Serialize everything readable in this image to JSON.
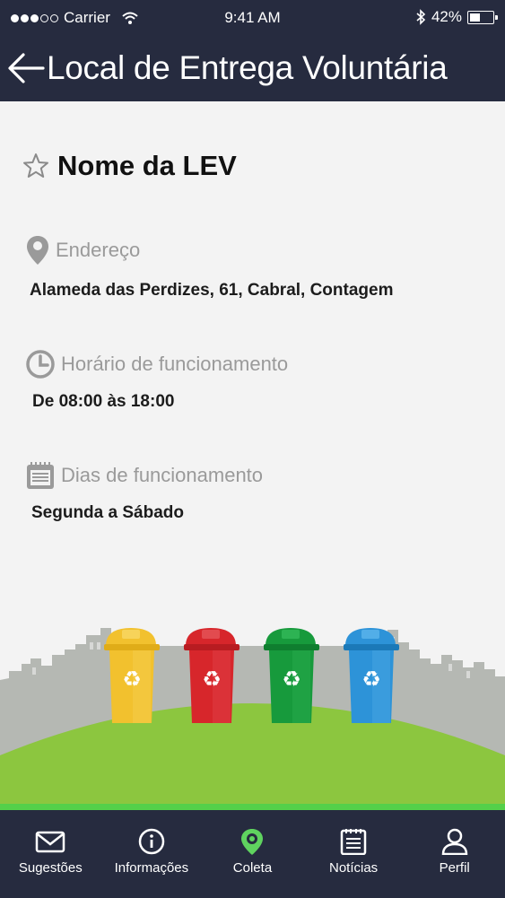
{
  "status_bar": {
    "carrier": "Carrier",
    "time": "9:41 AM",
    "battery": "42%",
    "battery_level": 0.42
  },
  "header": {
    "title": "Local de Entrega Voluntária"
  },
  "lev": {
    "name": "Nome da LEV"
  },
  "address": {
    "label": "Endereço",
    "value": "Alameda das Perdizes, 61, Cabral, Contagem"
  },
  "hours": {
    "label": "Horário de funcionamento",
    "value": "De 08:00 às 18:00"
  },
  "days": {
    "label": "Dias de funcionamento",
    "value": "Segunda a Sábado"
  },
  "bins": [
    {
      "color": "#f2c12e",
      "name": "yellow-bin"
    },
    {
      "color": "#d7262b",
      "name": "red-bin"
    },
    {
      "color": "#179a3c",
      "name": "green-bin"
    },
    {
      "color": "#2d93d8",
      "name": "blue-bin"
    }
  ],
  "tabs": [
    {
      "label": "Sugestões",
      "icon": "mail-icon"
    },
    {
      "label": "Informações",
      "icon": "info-icon"
    },
    {
      "label": "Coleta",
      "icon": "map-pin-icon",
      "active": true
    },
    {
      "label": "Notícias",
      "icon": "news-icon"
    },
    {
      "label": "Perfil",
      "icon": "user-icon"
    }
  ],
  "colors": {
    "header_bg": "#262b3f",
    "active_tab": "#5fd35f",
    "grass": "#8cc63f",
    "skyline": "#b5b8b3"
  }
}
